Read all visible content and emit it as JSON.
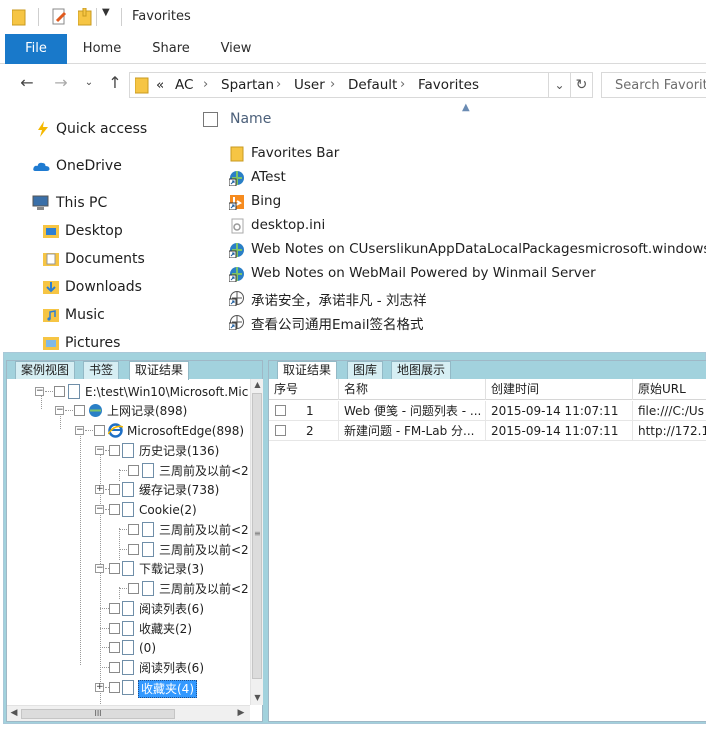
{
  "window": {
    "title": "Favorites"
  },
  "ribbon": {
    "tabs": [
      "File",
      "Home",
      "Share",
      "View"
    ]
  },
  "address": {
    "overflow_label": "«",
    "path": [
      "AC",
      "Spartan",
      "User",
      "Default",
      "Favorites"
    ],
    "search_placeholder": "Search Favorites"
  },
  "nav_pane": {
    "items": [
      {
        "label": "Quick access",
        "icon": "star-icon"
      },
      {
        "label": "OneDrive",
        "icon": "cloud-icon"
      },
      {
        "label": "This PC",
        "icon": "computer-icon"
      },
      {
        "label": "Desktop",
        "icon": "desktop-folder-icon"
      },
      {
        "label": "Documents",
        "icon": "documents-folder-icon"
      },
      {
        "label": "Downloads",
        "icon": "downloads-folder-icon"
      },
      {
        "label": "Music",
        "icon": "music-folder-icon"
      },
      {
        "label": "Pictures",
        "icon": "pictures-folder-icon"
      }
    ]
  },
  "file_list": {
    "column_name": "Name",
    "files": [
      {
        "name": "Favorites Bar",
        "icon": "folder-icon"
      },
      {
        "name": "ATest",
        "icon": "url-shortcut-icon"
      },
      {
        "name": "Bing",
        "icon": "bing-shortcut-icon"
      },
      {
        "name": "desktop.ini",
        "icon": "settings-file-icon"
      },
      {
        "name": "Web Notes on CUserslikunAppDataLocalPackagesmicrosoft.windows",
        "icon": "url-shortcut-icon"
      },
      {
        "name": "Web Notes on WebMail  Powered by Winmail Server",
        "icon": "url-shortcut-icon"
      },
      {
        "name": "承诺安全，承诺非凡 - 刘志祥",
        "icon": "url-shortcut-icon"
      },
      {
        "name": "查看公司通用Email签名格式",
        "icon": "url-shortcut-icon"
      }
    ]
  },
  "left_tabs": [
    "案例视图",
    "书签",
    "取证结果"
  ],
  "tree": {
    "nodes": [
      {
        "label": "E:\\test\\Win10\\Microsoft.Mic"
      },
      {
        "label": "上网记录(898)"
      },
      {
        "label": "MicrosoftEdge(898)"
      },
      {
        "label": "历史记录(136)"
      },
      {
        "label": "三周前及以前<2"
      },
      {
        "label": "缓存记录(738)"
      },
      {
        "label": "Cookie(2)"
      },
      {
        "label": "三周前及以前<2"
      },
      {
        "label": "三周前及以前<2"
      },
      {
        "label": "下载记录(3)"
      },
      {
        "label": "三周前及以前<2"
      },
      {
        "label": "阅读列表(6)"
      },
      {
        "label": "收藏夹(2)"
      },
      {
        "label": "(0)"
      },
      {
        "label": "阅读列表(6)"
      },
      {
        "label": "收藏夹(4)"
      }
    ],
    "hscroll_grip": "III"
  },
  "right_tabs": [
    "取证结果",
    "图库",
    "地图展示"
  ],
  "grid": {
    "headers": [
      "序号",
      "名称",
      "创建时间",
      "原始URL"
    ],
    "rows": [
      {
        "index": "1",
        "name": "Web 便笺 - 问题列表 - ...",
        "created": "2015-09-14 11:07:11",
        "url": "file:///C:/Us"
      },
      {
        "index": "2",
        "name": "新建问题 - FM-Lab 分...",
        "created": "2015-09-14 11:07:11",
        "url": "http://172.1"
      }
    ]
  },
  "colors": {
    "ribbon_file_tab": "#1979ca",
    "app_frame": "#a2d2dd",
    "tree_selection": "#3399ff",
    "folder_yellow": "#f6c544"
  }
}
